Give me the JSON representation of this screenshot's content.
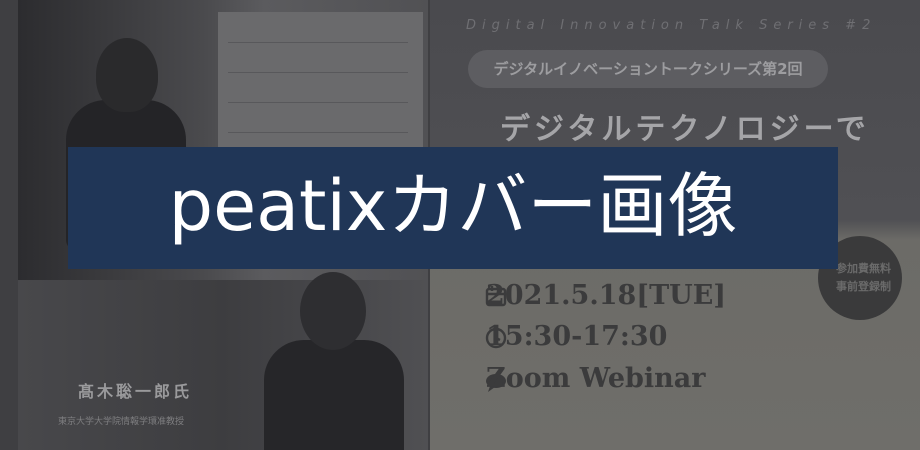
{
  "poster": {
    "deco_title": "Digital Innovation Talk Series #2",
    "series": "デジタルイノベーショントークシリーズ第2回",
    "main_title": "デジタルテクノロジーで",
    "date": "2021.5.18[TUE]",
    "time": "15:30-17:30",
    "venue": "Zoom Webinar",
    "badge_line1": "参加費無料",
    "badge_line2": "事前登録制",
    "speaker_name": "髙木聡一郎氏",
    "speaker_affiliation": "東京大学大学院情報学環准教授"
  },
  "overlay": {
    "label": "peatixカバー画像",
    "background_color": "#203657",
    "text_color": "#ffffff"
  },
  "icons": [
    "calendar-icon",
    "clock-icon",
    "chat-bubble-icon"
  ]
}
